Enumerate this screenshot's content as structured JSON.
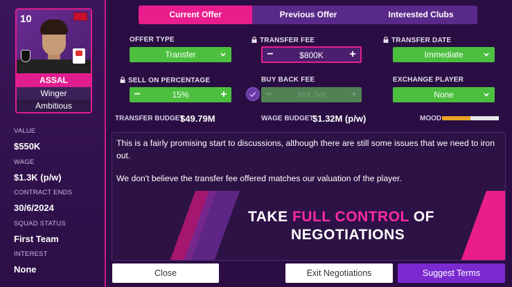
{
  "player": {
    "number": "10",
    "name": "ASSAL",
    "position": "Winger",
    "trait": "Ambitious"
  },
  "info": [
    {
      "label": "VALUE",
      "value": "$550K"
    },
    {
      "label": "WAGE",
      "value": "$1.3K (p/w)"
    },
    {
      "label": "CONTRACT ENDS",
      "value": "30/6/2024"
    },
    {
      "label": "SQUAD STATUS",
      "value": "First Team"
    },
    {
      "label": "INTEREST",
      "value": "None"
    }
  ],
  "tabs": [
    "Current Offer",
    "Previous Offer",
    "Interested Clubs"
  ],
  "fields": {
    "offer_type": {
      "label": "OFFER TYPE",
      "value": "Transfer"
    },
    "transfer_fee": {
      "label": "TRANSFER FEE",
      "value": "$800K"
    },
    "transfer_date": {
      "label": "TRANSFER DATE",
      "value": "Immediate"
    },
    "sell_on": {
      "label": "SELL ON PERCENTAGE",
      "value": "15%"
    },
    "buy_back": {
      "label": "BUY BACK FEE",
      "value": "Not Set"
    },
    "exchange": {
      "label": "EXCHANGE PLAYER",
      "value": "None"
    }
  },
  "budgets": {
    "transfer_label": "TRANSFER BUDGET",
    "transfer_value": "$49.79M",
    "wage_label": "WAGE BUDGET",
    "wage_value": "$1.32M (p/w)",
    "mood_label": "MOOD",
    "mood_level": 0.5
  },
  "message": {
    "line1": "This is a fairly promising start to discussions, although there are still some issues that we need to iron out.",
    "line2": "We don't believe the transfer fee offered matches our valuation of the player."
  },
  "banner": {
    "take": "TAKE",
    "highlight": "FULL CONTROL",
    "of": "OF",
    "line2": "NEGOTIATIONS"
  },
  "buttons": {
    "close": "Close",
    "exit": "Exit Negotiations",
    "suggest": "Suggest Terms"
  },
  "colors": {
    "accent": "#e91e8c",
    "green": "#4cbf3f",
    "purple": "#7a2ad0",
    "mood": "#e9a325"
  },
  "icons": [
    "lock-icon",
    "chevron-down-icon",
    "check-circle-icon"
  ]
}
